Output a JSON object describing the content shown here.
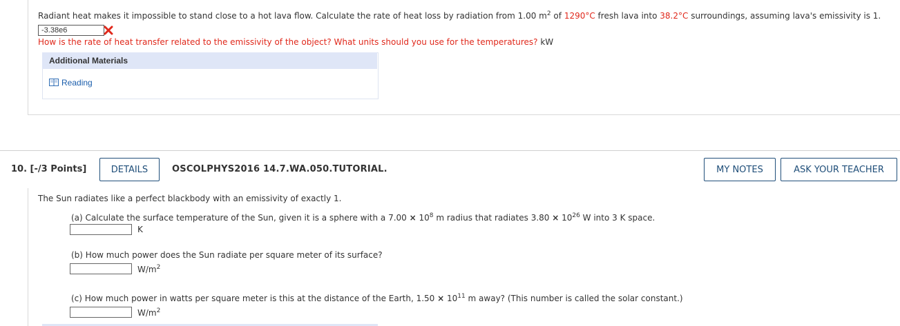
{
  "q9": {
    "text_pre": "Radiant heat makes it impossible to stand close to a hot lava flow. Calculate the rate of heat loss by radiation from 1.00 m",
    "text_sup": "2",
    "text_of": " of ",
    "text_temp_lava": "1290°C",
    "text_mid": " fresh lava into ",
    "text_temp_sur": "38.2°C",
    "text_post": " surroundings, assuming lava's emissivity is 1.",
    "answer_value": "-3.38e6",
    "hint": "How is the rate of heat transfer related to the emissivity of the object? What units should you use for the temperatures?",
    "hint_unit": " kW",
    "additional_materials": "Additional Materials",
    "reading_link": "Reading"
  },
  "q10": {
    "label": "10.  [-/3 Points]",
    "details_button": "DETAILS",
    "code": "OSCOLPHYS2016 14.7.WA.050.TUTORIAL.",
    "my_notes_button": "MY NOTES",
    "ask_teacher_button": "ASK YOUR TEACHER",
    "intro": "The Sun radiates like a perfect blackbody with an emissivity of exactly 1.",
    "part_a_pre": "(a) Calculate the surface temperature of the Sun, given it is a sphere with a 7.00 ",
    "part_a_times1": "×",
    "part_a_mid1": " 10",
    "part_a_exp1": "8",
    "part_a_mid2": " m radius that radiates 3.80 ",
    "part_a_times2": "×",
    "part_a_mid3": " 10",
    "part_a_exp2": "26",
    "part_a_post": " W into 3 K space.",
    "part_a_unit": "K",
    "part_b": "(b) How much power does the Sun radiate per square meter of its surface?",
    "part_b_unit": "W/m",
    "part_b_unit_sup": "2",
    "part_c_pre": "(c) How much power in watts per square meter is this at the distance of the Earth, 1.50 ",
    "part_c_times": "×",
    "part_c_mid": " 10",
    "part_c_exp": "11",
    "part_c_post": " m away? (This number is called the solar constant.)",
    "part_c_unit": "W/m",
    "part_c_unit_sup": "2"
  },
  "colors": {
    "error_red": "#e0281b",
    "link_blue": "#1a5dab",
    "button_navy": "#1f4e79",
    "panel_blue": "#dfe6f7"
  },
  "icons": {
    "wrong": "x-mark-icon",
    "reading": "book-icon"
  }
}
